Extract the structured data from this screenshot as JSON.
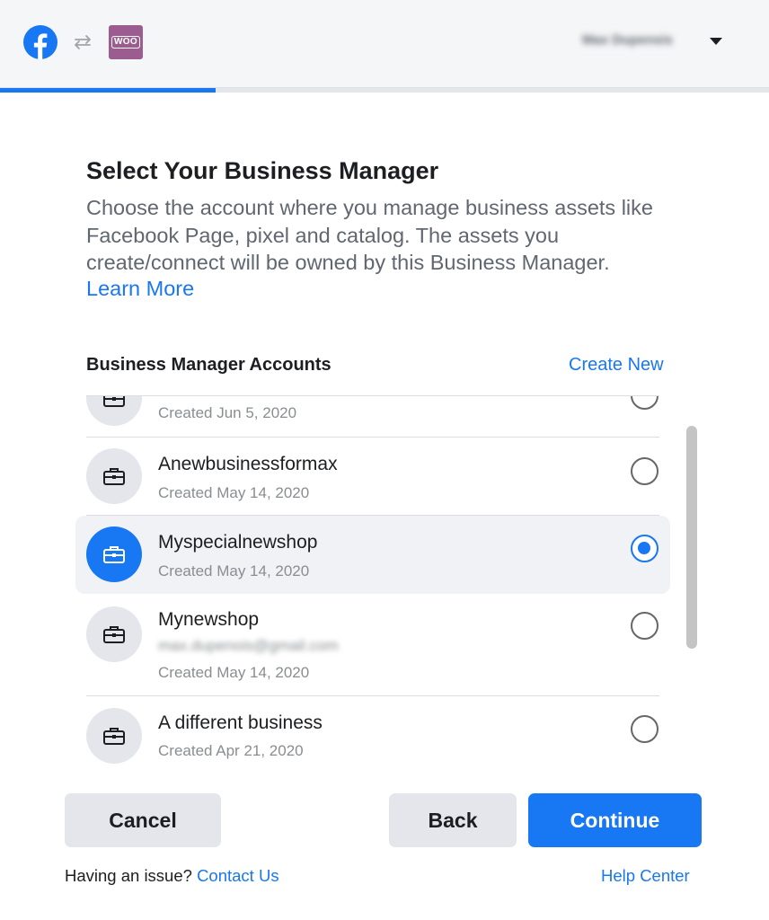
{
  "header": {
    "facebook_logo": "facebook-logo",
    "sync_icon": "sync-arrows-icon",
    "woo_logo_text": "WOO",
    "user_name": "Max Dupensis",
    "progress_fraction": 0.28
  },
  "main": {
    "title": "Select Your Business Manager",
    "description": "Choose the account where you manage business assets like Facebook Page, pixel and catalog. The assets you create/connect will be owned by this Business Manager.",
    "learn_more": "Learn More",
    "section_label": "Business Manager Accounts",
    "create_new": "Create New"
  },
  "accounts": [
    {
      "name": "",
      "email": "",
      "created": "Created Jun 5, 2020",
      "selected": false
    },
    {
      "name": "Anewbusinessformax",
      "email": "",
      "created": "Created May 14, 2020",
      "selected": false
    },
    {
      "name": "Myspecialnewshop",
      "email": "",
      "created": "Created May 14, 2020",
      "selected": true
    },
    {
      "name": "Mynewshop",
      "email": "max.dupenois@gmail.com",
      "created": "Created May 14, 2020",
      "selected": false
    },
    {
      "name": "A different business",
      "email": "",
      "created": "Created Apr 21, 2020",
      "selected": false
    }
  ],
  "buttons": {
    "cancel": "Cancel",
    "back": "Back",
    "continue": "Continue"
  },
  "footer": {
    "issue_text": "Having an issue?",
    "contact_us": "Contact Us",
    "help_center": "Help Center"
  },
  "colors": {
    "accent": "#1877f2",
    "woo": "#9b5c8f"
  }
}
